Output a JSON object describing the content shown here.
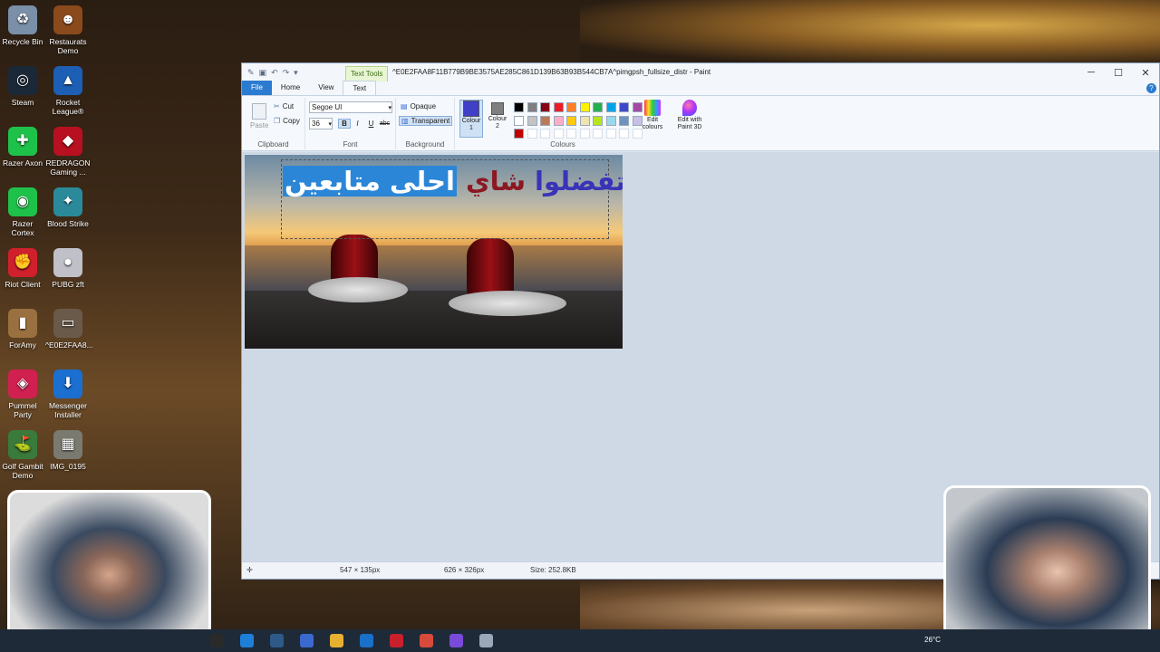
{
  "desktop": {
    "icons": [
      {
        "label": "Recycle Bin",
        "color": "#7a8fa8",
        "glyph": "♻"
      },
      {
        "label": "Restaurats Demo",
        "color": "#8a4a1c",
        "glyph": "☻"
      },
      {
        "label": "Steam",
        "color": "#1b2838",
        "glyph": "◎"
      },
      {
        "label": "Rocket League®",
        "color": "#1d5fb4",
        "glyph": "▲"
      },
      {
        "label": "Razer Axon",
        "color": "#1ec24a",
        "glyph": "✚"
      },
      {
        "label": "REDRAGON Gaming ...",
        "color": "#b81020",
        "glyph": "◆"
      },
      {
        "label": "Razer Cortex",
        "color": "#1ec24a",
        "glyph": "◉"
      },
      {
        "label": "Blood Strike",
        "color": "#2a8a9a",
        "glyph": "✦"
      },
      {
        "label": "Riot Client",
        "color": "#d0202c",
        "glyph": "✊"
      },
      {
        "label": "PUBG zft",
        "color": "#c0c0c8",
        "glyph": "●"
      },
      {
        "label": "ForAmy",
        "color": "#9a7040",
        "glyph": "▮"
      },
      {
        "label": "^E0E2FAA8...",
        "color": "#6a5a4a",
        "glyph": "▭"
      },
      {
        "label": "Pummel Party",
        "color": "#d02050",
        "glyph": "◈"
      },
      {
        "label": "Messenger Installer",
        "color": "#1a6fd0",
        "glyph": "⬇"
      },
      {
        "label": "Golf Gambit Demo",
        "color": "#3a7a3a",
        "glyph": "⛳"
      },
      {
        "label": "IMG_0195",
        "color": "#7a7a70",
        "glyph": "▦"
      }
    ]
  },
  "paint": {
    "title": "^E0E2FAA8F11B779B9BE3575AE285C861D139B63B93B544CB7A^pimgpsh_fullsize_distr - Paint",
    "context_tab": "Text Tools",
    "tabs": {
      "file": "File",
      "home": "Home",
      "view": "View",
      "text": "Text"
    },
    "clipboard": {
      "paste": "Paste",
      "cut": "Cut",
      "copy": "Copy",
      "label": "Clipboard"
    },
    "font": {
      "family": "Segoe UI",
      "size": "36",
      "bold": "B",
      "italic": "I",
      "underline": "U",
      "strike": "abc",
      "label": "Font"
    },
    "background": {
      "opaque": "Opaque",
      "transparent": "Transparent",
      "label": "Background"
    },
    "colours": {
      "colour1": "Colour 1",
      "colour2": "Colour 2",
      "colour1_value": "#3f3fc8",
      "colour2_value": "#7f7f7f",
      "edit": "Edit colours",
      "edit3d": "Edit with Paint 3D",
      "label": "Colours",
      "palette": [
        "#000000",
        "#7f7f7f",
        "#880015",
        "#ed1c24",
        "#ff7f27",
        "#fff200",
        "#22b14c",
        "#00a2e8",
        "#3f48cc",
        "#a349a4",
        "#ffffff",
        "#c3c3c3",
        "#b97a57",
        "#ffaec9",
        "#ffc90e",
        "#efe4b0",
        "#b5e61d",
        "#99d9ea",
        "#7092be",
        "#c8bfe7",
        "#c00000"
      ]
    },
    "canvas_text": {
      "word1": "اتفضلوا",
      "word2": "شاي",
      "word3": "احلى متابعين"
    },
    "status": {
      "selection": "547 × 135px",
      "image_size": "626 × 326px",
      "file_size": "Size: 252.8KB"
    }
  },
  "taskbar": {
    "weather": "26°C",
    "icons": [
      "#2a2a2a",
      "#1e7fd8",
      "#2e5a8a",
      "#3a6ad0",
      "#e8b030",
      "#1a70c8",
      "#c8202c",
      "#d84a3a",
      "#7a4ad8",
      "#9aa8b8"
    ]
  }
}
